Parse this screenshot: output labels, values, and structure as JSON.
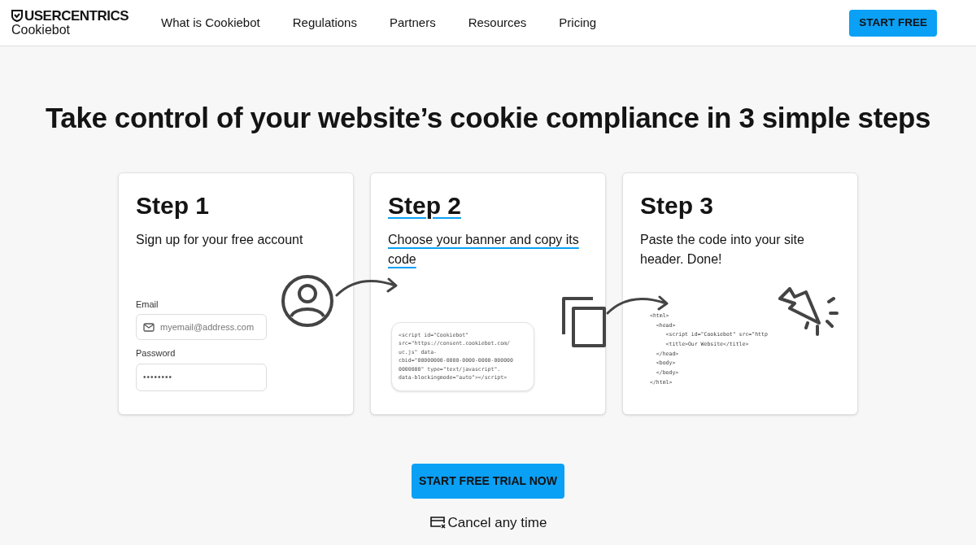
{
  "header": {
    "logo_brand": "USERCENTRICS",
    "logo_product": "Cookiebot",
    "nav": [
      "What is Cookiebot",
      "Regulations",
      "Partners",
      "Resources",
      "Pricing"
    ],
    "cta": "START FREE"
  },
  "headline": "Take control of your website’s cookie compliance in 3 simple steps",
  "steps": [
    {
      "kind": "signup",
      "title": "Step 1",
      "text": "Sign up for your free account",
      "highlighted": false,
      "email_label": "Email",
      "email_placeholder": "myemail@address.com",
      "password_label": "Password",
      "password_value": "••••••••"
    },
    {
      "kind": "banner",
      "title": "Step 2",
      "text": "Choose your banner and copy its code",
      "highlighted": true,
      "code_lines": [
        "<script id=\"Cookiebot\"",
        "src=\"https://consent.cookiebot.com/",
        "uc.js\" data-",
        "cbid=\"00000000-0000-0000-0000-000000",
        "0000000\" type=\"text/javascript\".",
        "data-blockingmode=\"auto\"></script>"
      ]
    },
    {
      "kind": "paste",
      "title": "Step 3",
      "text": "Paste the code into your site header. Done!",
      "highlighted": false,
      "code_lines": [
        "<html>",
        "  <head>",
        "     <script id=\"Cookiebot\" src=\"http",
        "     <title>Our Website</title>",
        "  </head>",
        "  <body>",
        "  </body>",
        "</html>"
      ]
    }
  ],
  "trial_button": "START FREE TRIAL NOW",
  "cancel_note": "Cancel any time"
}
